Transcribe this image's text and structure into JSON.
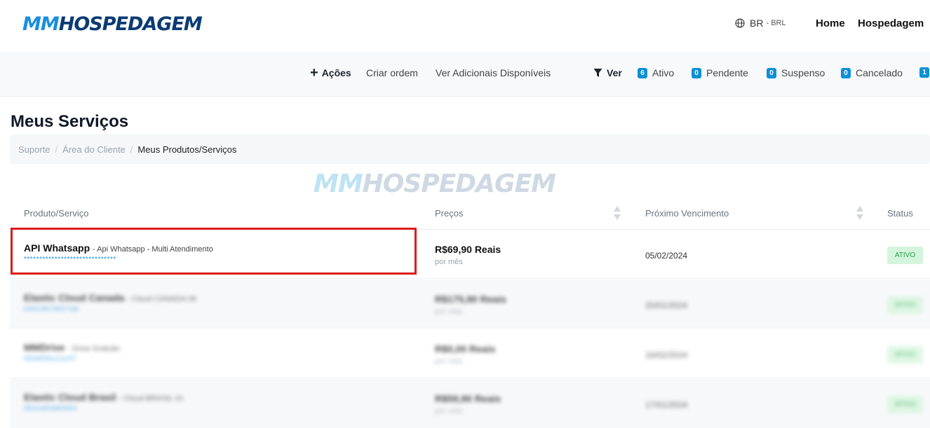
{
  "header": {
    "logo": {
      "part1": "MM",
      "part2": "HOSPEDAGEM"
    },
    "language": {
      "code": "BR",
      "currency": "BRL",
      "icon": "globe-icon"
    },
    "nav": [
      {
        "label": "Home"
      },
      {
        "label": "Hospedagem"
      }
    ]
  },
  "toolbar": {
    "actions_label": "Ações",
    "create_order": "Criar ordem",
    "view_addons": "Ver Adicionais Disponíveis",
    "filter_label": "Ver",
    "filters": [
      {
        "count": "6",
        "label": "Ativo"
      },
      {
        "count": "0",
        "label": "Pendente"
      },
      {
        "count": "0",
        "label": "Suspenso"
      },
      {
        "count": "0",
        "label": "Cancelado"
      },
      {
        "count": "1",
        "label": ""
      }
    ]
  },
  "page": {
    "title": "Meus Serviços",
    "breadcrumb": [
      "Suporte",
      "Área do Cliente",
      "Meus Produtos/Serviços"
    ]
  },
  "watermark": {
    "part1": "MM",
    "part2": "HOSPEDAGEM"
  },
  "table": {
    "columns": [
      "Produto/Serviço",
      "Preços",
      "Próximo Vencimento",
      "Status"
    ],
    "rows": [
      {
        "name": "API Whatsapp",
        "desc": "- Api Whatsapp - Multi Atendimento",
        "domain": "******************************",
        "price": "R$69,90 Reais",
        "cycle": "por mês",
        "due": "05/02/2024",
        "status": "ATIVO"
      },
      {
        "name": "Elastic Cloud Canada",
        "desc": "- Cloud CANADA 06",
        "domain": "64919679027ab",
        "price": "R$175,90 Reais",
        "cycle": "por mês",
        "due": "20/01/2024",
        "status": "ATIVO"
      },
      {
        "name": "MMDrive",
        "desc": "- Drive Gratuito",
        "domain": "65085f0c21e07",
        "price": "R$0,00 Reais",
        "cycle": "por mês",
        "due": "16/02/2024",
        "status": "ATIVO"
      },
      {
        "name": "Elastic Cloud Brasil",
        "desc": "- Cloud BRASIL 01",
        "domain": "652ed50df2852",
        "price": "R$59,90 Reais",
        "cycle": "por mês",
        "due": "17/01/2024",
        "status": "ATIVO"
      }
    ]
  },
  "colors": {
    "brand_light": "#1a8ee0",
    "brand_dark": "#0b3b73",
    "badge": "#0f8fd6",
    "status_bg": "#d4f5dc",
    "status_text": "#25a24a",
    "highlight": "#dd1a1a"
  }
}
